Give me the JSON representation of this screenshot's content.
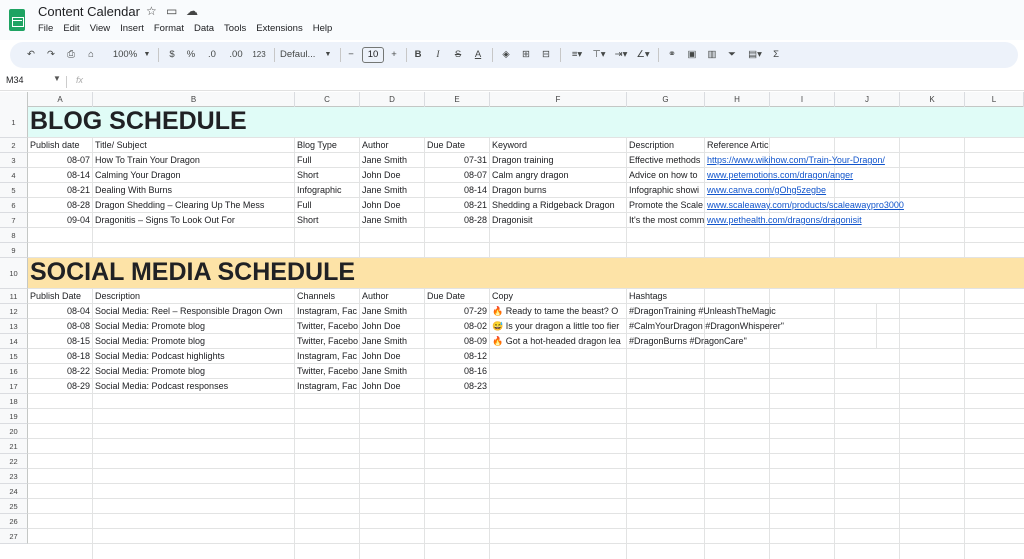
{
  "doc": {
    "title": "Content Calendar"
  },
  "menu": [
    "File",
    "Edit",
    "View",
    "Insert",
    "Format",
    "Data",
    "Tools",
    "Extensions",
    "Help"
  ],
  "toolbar": {
    "zoom": "100%",
    "currency": "$",
    "percent": "%",
    "dec_decrease": ".0",
    "dec_increase": ".00",
    "format_123": "123",
    "font": "Defaul...",
    "font_size": "10",
    "minus": "−",
    "plus": "+",
    "bold": "B",
    "italic": "I",
    "strike": "S",
    "text_color": "A",
    "sum": "Σ"
  },
  "formula": {
    "cell_ref": "M34",
    "fx": "fx"
  },
  "columns": [
    "A",
    "B",
    "C",
    "D",
    "E",
    "F",
    "G",
    "H",
    "I",
    "J",
    "K",
    "L"
  ],
  "rows": [
    "1",
    "2",
    "3",
    "4",
    "5",
    "6",
    "7",
    "8",
    "9",
    "10",
    "11",
    "12",
    "13",
    "14",
    "15",
    "16",
    "17",
    "18",
    "19",
    "20",
    "21",
    "22",
    "23",
    "24",
    "25",
    "26",
    "27"
  ],
  "blog": {
    "banner": "BLOG SCHEDULE",
    "headers": [
      "Publish date",
      "Title/ Subject",
      "Blog Type",
      "Author",
      "Due Date",
      "Keyword",
      "Description",
      "Reference Article"
    ],
    "entries": [
      [
        "08-07",
        "How To Train Your Dragon",
        "Full",
        "Jane Smith",
        "07-31",
        "Dragon training",
        "Effective methods",
        "https://www.wikihow.com/Train-Your-Dragon/"
      ],
      [
        "08-14",
        "Calming Your Dragon",
        "Short",
        "John Doe",
        "08-07",
        "Calm angry dragon",
        "Advice on how to",
        "www.petemotions.com/dragon/anger"
      ],
      [
        "08-21",
        "Dealing With Burns",
        "Infographic",
        "Jane Smith",
        "08-14",
        "Dragon burns",
        "Infographic showi",
        "www.canva.com/gOhg5zegbe"
      ],
      [
        "08-28",
        "Dragon Shedding – Clearing Up The Mess",
        "Full",
        "John Doe",
        "08-21",
        "Shedding a Ridgeback Dragon",
        "Promote the Scale",
        "www.scaleaway.com/products/scaleawaypro3000"
      ],
      [
        "09-04",
        "Dragonitis – Signs To Look Out For",
        "Short",
        "Jane Smith",
        "08-28",
        "Dragonisit",
        "It's the most comm",
        "www.pethealth.com/dragons/dragonisit"
      ]
    ]
  },
  "social": {
    "banner": "SOCIAL MEDIA SCHEDULE",
    "headers": [
      "Publish Date",
      "Description",
      "Channels",
      "Author",
      "Due Date",
      "Copy",
      "Hashtags"
    ],
    "entries": [
      [
        "08-04",
        "Social Media: Reel – Responsible Dragon Own",
        "Instagram, Fac",
        "Jane Smith",
        "07-29",
        "🔥 Ready to tame the beast? O",
        "#DragonTraining #UnleashTheMagic"
      ],
      [
        "08-08",
        "Social Media: Promote blog",
        "Twitter, Facebo",
        "John Doe",
        "08-02",
        "😅 Is your dragon a little too fier",
        "#CalmYourDragon #DragonWhisperer\""
      ],
      [
        "08-15",
        "Social Media: Promote blog",
        "Twitter, Facebo",
        "Jane Smith",
        "08-09",
        "🔥 Got a hot-headed dragon lea",
        "#DragonBurns #DragonCare\""
      ],
      [
        "08-18",
        "Social Media: Podcast highlights",
        "Instagram, Fac",
        "John Doe",
        "08-12",
        "",
        ""
      ],
      [
        "08-22",
        "Social Media: Promote blog",
        "Twitter, Facebo",
        "Jane Smith",
        "08-16",
        "",
        ""
      ],
      [
        "08-29",
        "Social Media: Podcast responses",
        "Instagram, Fac",
        "John Doe",
        "08-23",
        "",
        ""
      ]
    ]
  },
  "colors": {
    "blog_band": "#e0fcf7",
    "social_band": "#fde3a7",
    "link": "#1155cc",
    "sheets_green": "#1ea362"
  }
}
